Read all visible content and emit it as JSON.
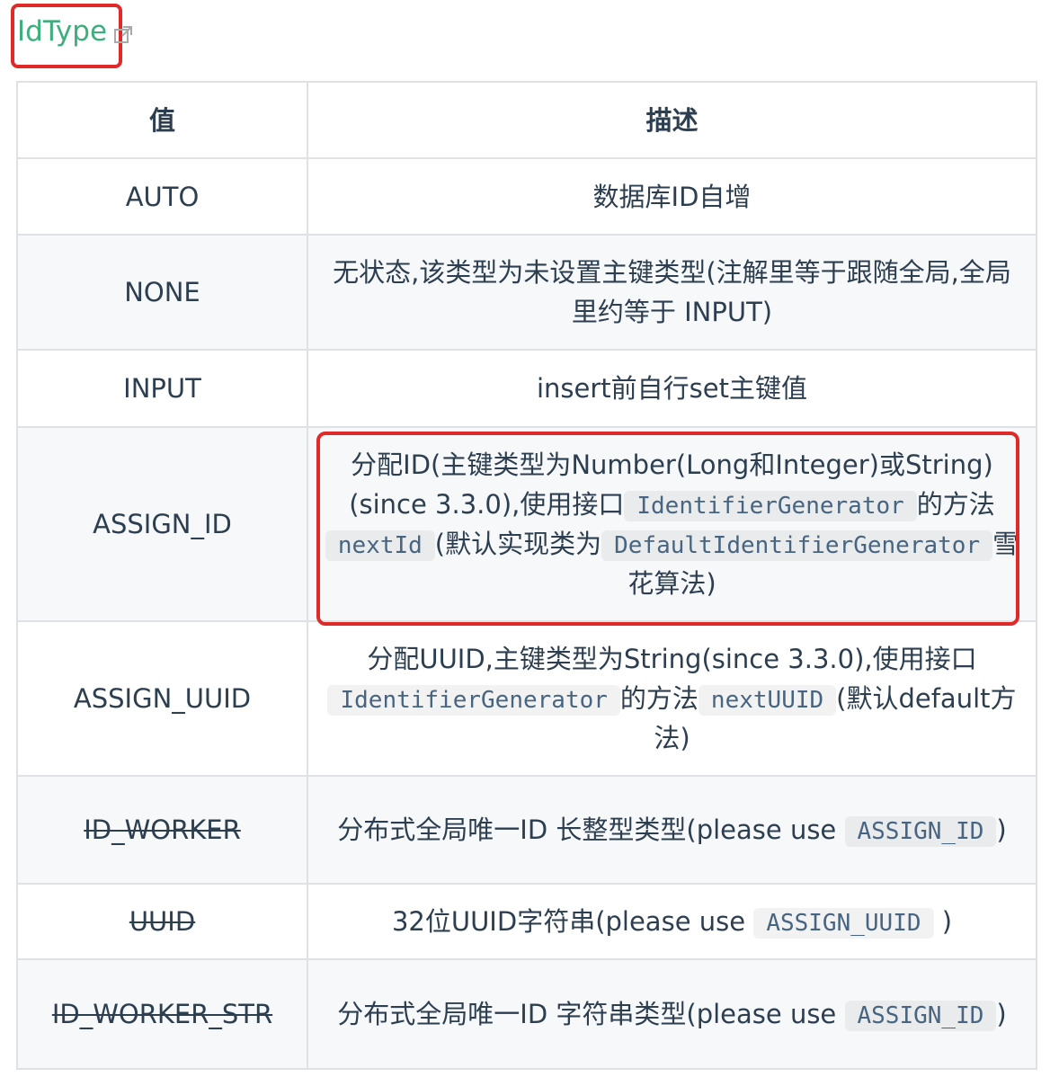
{
  "title": {
    "text": "IdType",
    "link_color": "#3eaf7c"
  },
  "table": {
    "headers": {
      "value": "值",
      "description": "描述"
    },
    "rows": {
      "auto": {
        "value": "AUTO",
        "desc": "数据库ID自增"
      },
      "none": {
        "value": "NONE",
        "desc": "无状态,该类型为未设置主键类型(注解里等于跟随全局,全局里约等于 INPUT)"
      },
      "input": {
        "value": "INPUT",
        "desc": "insert前自行set主键值"
      },
      "assign_id": {
        "value": "ASSIGN_ID",
        "desc_1": "分配ID(主键类型为Number(Long和Integer)或String)(since 3.3.0),使用接口",
        "code_1": "IdentifierGenerator",
        "desc_2": "的方法",
        "code_2": "nextId",
        "desc_3": "(默认实现类为",
        "code_3": "DefaultIdentifierGenerator",
        "desc_4": "雪花算法)"
      },
      "assign_uuid": {
        "value": "ASSIGN_UUID",
        "desc_1": "分配UUID,主键类型为String(since 3.3.0),使用接口",
        "code_1": "IdentifierGenerator",
        "desc_2": "的方法",
        "code_2": "nextUUID",
        "desc_3": "(默认default方法)"
      },
      "id_worker": {
        "value": "ID_WORKER",
        "desc_1": "分布式全局唯一ID 长整型类型(please use",
        "code_1": "ASSIGN_ID",
        "desc_2": ")"
      },
      "uuid": {
        "value": "UUID",
        "desc_1": "32位UUID字符串(please use",
        "code_1": "ASSIGN_UUID",
        "desc_2": ")"
      },
      "id_worker_str": {
        "value": "ID_WORKER_STR",
        "desc_1": "分布式全局唯一ID 字符串类型(please use",
        "code_1": "ASSIGN_ID",
        "desc_2": ")"
      }
    }
  },
  "icons": {
    "title_link": "external-link-icon"
  },
  "colors": {
    "highlight_border": "#e02a2a",
    "table_border": "#dfe2e5",
    "stripe": "#f6f8fa",
    "code_text": "#476582"
  }
}
